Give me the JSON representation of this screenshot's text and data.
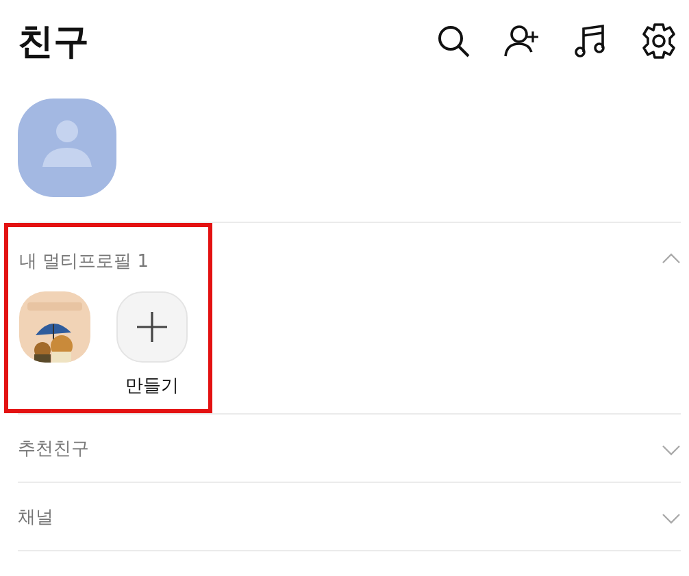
{
  "header": {
    "title": "친구"
  },
  "sections": [
    {
      "title": "내 멀티프로필 1",
      "expanded": true,
      "highlighted": true,
      "tiles": [
        {
          "kind": "picture"
        },
        {
          "kind": "create",
          "label": "만들기"
        }
      ]
    },
    {
      "title": "추천친구",
      "expanded": false,
      "highlighted": false
    },
    {
      "title": "채널",
      "expanded": false,
      "highlighted": false
    }
  ]
}
